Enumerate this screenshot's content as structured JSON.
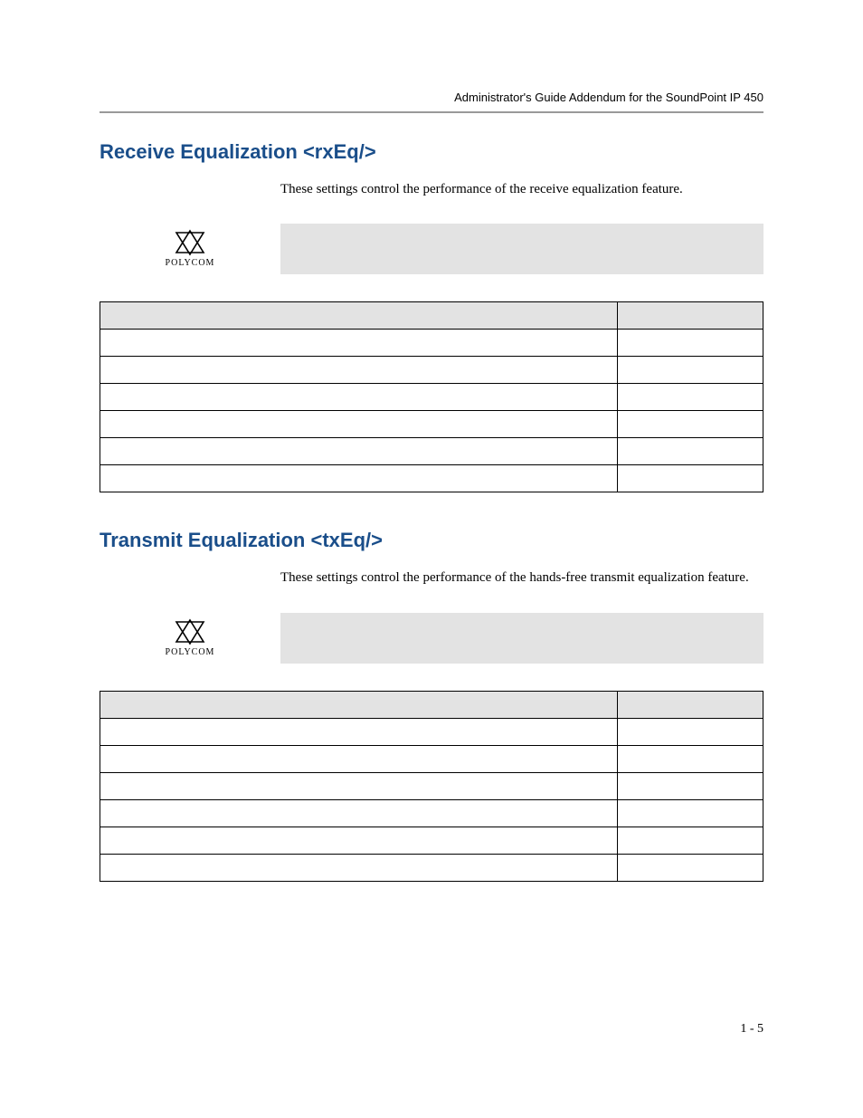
{
  "header": {
    "running_head": "Administrator's Guide Addendum for the SoundPoint IP 450"
  },
  "sections": [
    {
      "title": "Receive Equalization <rxEq/>",
      "intro": "These settings control the performance of the receive equalization feature.",
      "logo_caption": "POLYCOM",
      "note_text": "",
      "table": {
        "headers": [
          "",
          ""
        ],
        "rows": [
          [
            "",
            ""
          ],
          [
            "",
            ""
          ],
          [
            "",
            ""
          ],
          [
            "",
            ""
          ],
          [
            "",
            ""
          ],
          [
            "",
            ""
          ]
        ]
      }
    },
    {
      "title": "Transmit Equalization <txEq/>",
      "intro": "These settings control the performance of the hands-free transmit equalization feature.",
      "logo_caption": "POLYCOM",
      "note_text": "",
      "table": {
        "headers": [
          "",
          ""
        ],
        "rows": [
          [
            "",
            ""
          ],
          [
            "",
            ""
          ],
          [
            "",
            ""
          ],
          [
            "",
            ""
          ],
          [
            "",
            ""
          ],
          [
            "",
            ""
          ]
        ]
      }
    }
  ],
  "footer": {
    "page_number": "1 - 5"
  }
}
